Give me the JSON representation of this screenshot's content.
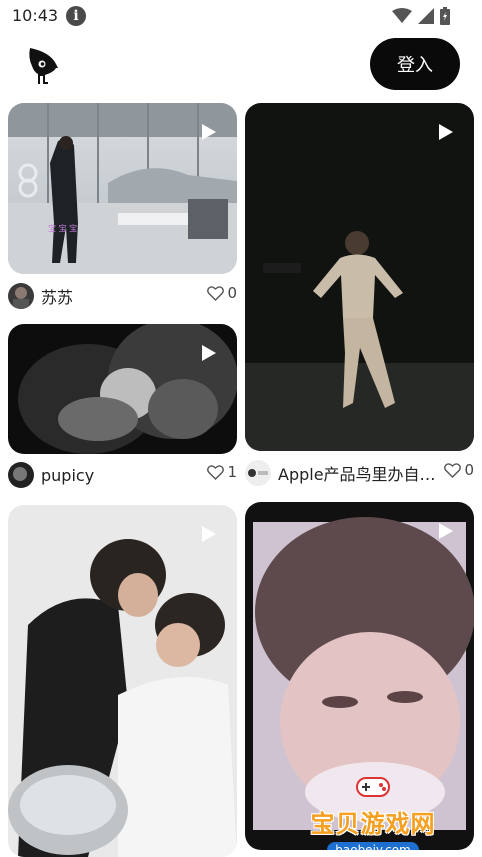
{
  "status_bar": {
    "time": "10:43"
  },
  "header": {
    "login_label": "登入"
  },
  "feed": [
    {
      "author": "苏苏",
      "likes": "0"
    },
    {
      "author": "pupicy",
      "likes": "1"
    },
    {
      "author": "Apple产品鸟里办自…",
      "likes": "0"
    },
    {
      "author": "",
      "likes": ""
    }
  ],
  "watermark": {
    "title": "宝贝游戏网",
    "url": "baobeiy.com"
  },
  "icons": {
    "info": "info-icon",
    "wifi": "wifi-icon",
    "signal": "signal-icon",
    "battery": "battery-icon",
    "logo": "bird-logo-icon",
    "play": "play-icon",
    "heart": "heart-icon"
  }
}
